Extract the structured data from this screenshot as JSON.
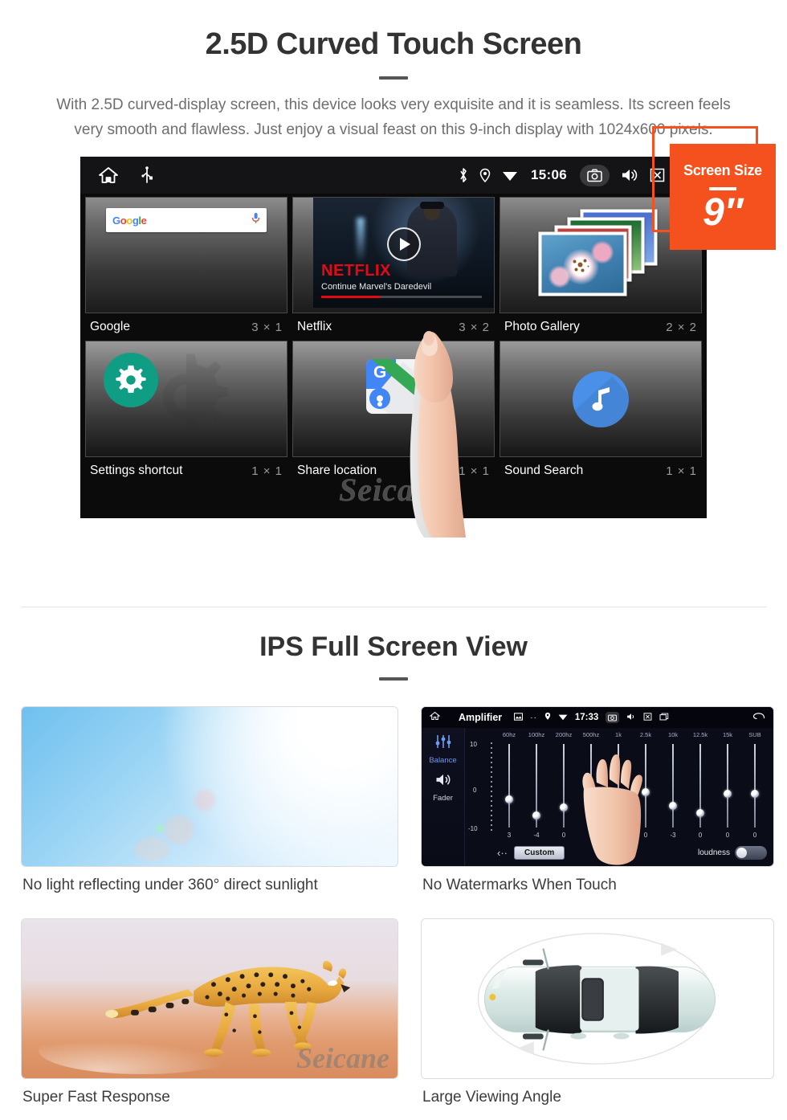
{
  "section1": {
    "title": "2.5D Curved Touch Screen",
    "paragraph": "With 2.5D curved-display screen, this device looks very exquisite and it is seamless. Its screen feels very smooth and flawless. Just enjoy a visual feast on this 9-inch display with 1024x600 pixels.",
    "badge": {
      "title": "Screen Size",
      "value": "9″"
    },
    "accent_color": "#f4511e"
  },
  "device": {
    "statusbar": {
      "home_icon": "home-icon",
      "usb_icon": "usb-icon",
      "bluetooth_icon": "bluetooth-icon",
      "location_icon": "location-icon",
      "wifi_icon": "wifi-icon",
      "clock": "15:06",
      "camera_icon": "camera-icon",
      "volume_icon": "volume-icon",
      "close_icon": "close-box-icon",
      "recents_icon": "recent-apps-icon"
    },
    "widgets": [
      {
        "label": "Google",
        "size": "3 × 1",
        "icon": "google-search-widget"
      },
      {
        "label": "Netflix",
        "size": "3 × 2",
        "icon": "netflix-widget"
      },
      {
        "label": "Photo Gallery",
        "size": "2 × 2",
        "icon": "photo-gallery-widget"
      },
      {
        "label": "Settings shortcut",
        "size": "1 × 1",
        "icon": "settings-gear-icon"
      },
      {
        "label": "Share location",
        "size": "1 × 1",
        "icon": "google-maps-icon"
      },
      {
        "label": "Sound Search",
        "size": "1 × 1",
        "icon": "music-note-icon"
      }
    ],
    "google_widget": {
      "logo": "Google",
      "mic_icon": "microphone-icon"
    },
    "netflix_widget": {
      "brand": "NETFLIX",
      "subtitle": "Continue Marvel's Daredevil",
      "play_icon": "play-icon"
    },
    "watermark": "Seicane"
  },
  "section2": {
    "title": "IPS Full Screen View",
    "cards": [
      {
        "caption": "No light reflecting under 360° direct sunlight",
        "image": "sunny-sky-photo"
      },
      {
        "caption": "No Watermarks When Touch",
        "image": "amplifier-equalizer-screenshot"
      },
      {
        "caption": "Super Fast Response",
        "image": "running-cheetah-photo"
      },
      {
        "caption": "Large Viewing Angle",
        "image": "car-top-view-illustration"
      }
    ]
  },
  "amplifier": {
    "home_icon": "home-icon",
    "title": "Amplifier",
    "gallery_icon": "gallery-icon",
    "dots_icon": "more-icon",
    "location_icon": "location-icon",
    "wifi_icon": "wifi-icon",
    "clock": "17:33",
    "camera_icon": "camera-icon",
    "volume_icon": "volume-icon",
    "close_icon": "close-box-icon",
    "recents_icon": "recent-apps-icon",
    "back_icon": "back-icon",
    "sidebar": [
      {
        "label": "Balance",
        "icon": "sliders-icon",
        "selected": true
      },
      {
        "label": "Fader",
        "icon": "speaker-icon",
        "selected": false
      }
    ],
    "scale": {
      "max": "10",
      "mid": "0",
      "min": "-10"
    },
    "bands": [
      "60hz",
      "100hz",
      "200hz",
      "500hz",
      "1k",
      "2.5k",
      "10k",
      "12.5k",
      "15k",
      "SUB"
    ],
    "values": [
      "3",
      "-4",
      "0",
      "0",
      "-3",
      "0",
      "-3",
      "0",
      "0",
      "0"
    ],
    "preset_label": "Custom",
    "loudness_label": "loudness",
    "prev_icon": "chevron-left-icon"
  },
  "watermark": "Seicane"
}
